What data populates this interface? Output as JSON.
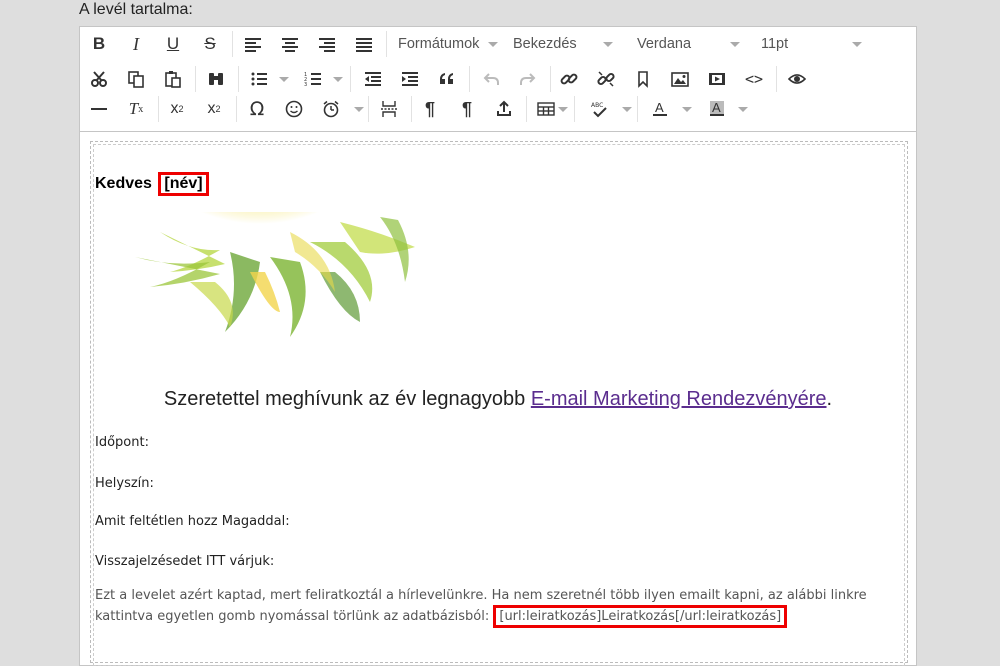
{
  "section_label": "A levél tartalma:",
  "toolbar": {
    "formats_label": "Formátumok",
    "block_label": "Bekezdés",
    "font_label": "Verdana",
    "size_label": "11pt"
  },
  "content": {
    "greeting_prefix": "Kedves",
    "name_placeholder": "[név]",
    "invite_text": "Szeretettel meghívunk az év legnagyobb ",
    "invite_link": "E-mail Marketing Rendezvényére",
    "invite_end": ".",
    "fields": [
      "Időpont:",
      "Helyszín:",
      "Amit feltétlen hozz Magaddal:",
      "Visszajelzésedet ITT várjuk:"
    ],
    "footer_text": "Ezt a levelet azért kaptad, mert feliratkoztál a hírlevelünkre. Ha nem szeretnél több ilyen emailt kapni, az alábbi linkre kattintva egyetlen gomb nyomással törlünk az adatbázisból:",
    "unsubscribe_tag": "[url:leiratkozás]Leiratkozás[/url:leiratkozás]"
  },
  "colors": {
    "accent_red": "#e00000",
    "link_purple": "#5b2d8e"
  }
}
